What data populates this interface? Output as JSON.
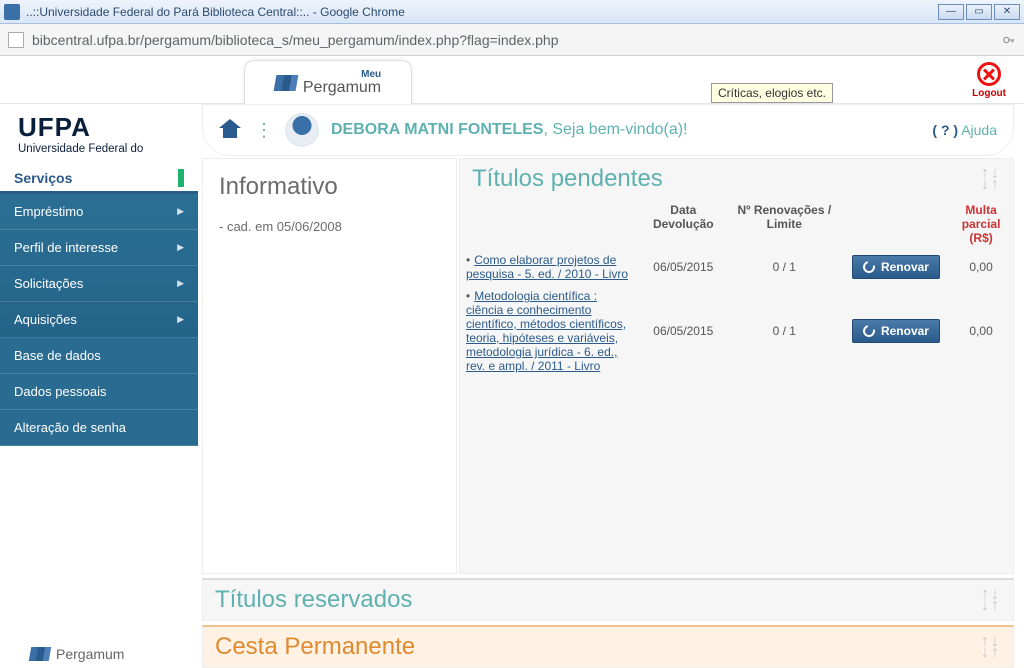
{
  "window": {
    "title": "..::Universidade Federal do Pará Biblioteca Central::.. - Google Chrome"
  },
  "url": "bibcentral.ufpa.br/pergamum/biblioteca_s/meu_pergamum/index.php?flag=index.php",
  "brand_tab": {
    "top": "Meu",
    "name": "Pergamum"
  },
  "logout": "Logout",
  "ufpa": {
    "abbrev": "UFPA",
    "full": "Universidade Federal do"
  },
  "tooltip": "Críticas, elogios etc.",
  "welcome": {
    "name": "DEBORA MATNI FONTELES",
    "suffix": ", Seja bem-vindo(a)!"
  },
  "help": {
    "q": "( ? )",
    "label": "Ajuda"
  },
  "sidebar": {
    "header": "Serviços",
    "items": [
      {
        "label": "Empréstimo",
        "arrow": true
      },
      {
        "label": "Perfil de interesse",
        "arrow": true
      },
      {
        "label": "Solicitações",
        "arrow": true
      },
      {
        "label": "Aquisições",
        "arrow": true
      },
      {
        "label": "Base de dados",
        "arrow": false
      },
      {
        "label": "Dados pessoais",
        "arrow": false
      },
      {
        "label": "Alteração de senha",
        "arrow": false
      }
    ],
    "footer": "Pergamum"
  },
  "info": {
    "title": "Informativo",
    "cad": "- cad. em 05/06/2008"
  },
  "pending": {
    "title": "Títulos pendentes",
    "headers": {
      "title": "",
      "due": "Data Devolução",
      "renew": "Nº Renovações / Limite",
      "action": "",
      "fine": "Multa parcial (R$)"
    },
    "btn": "Renovar",
    "rows": [
      {
        "title": "Como elaborar projetos de pesquisa - 5. ed. / 2010 - Livro",
        "due": "06/05/2015",
        "renew": "0 / 1",
        "fine": "0,00"
      },
      {
        "title": "Metodologia científica : ciência e conhecimento científico, métodos científicos, teoria, hipóteses e variáveis, metodologia jurídica - 6. ed., rev. e ampl. / 2011 - Livro",
        "due": "06/05/2015",
        "renew": "0 / 1",
        "fine": "0,00"
      }
    ]
  },
  "reserved": {
    "title": "Títulos reservados"
  },
  "basket": {
    "title": "Cesta Permanente"
  }
}
